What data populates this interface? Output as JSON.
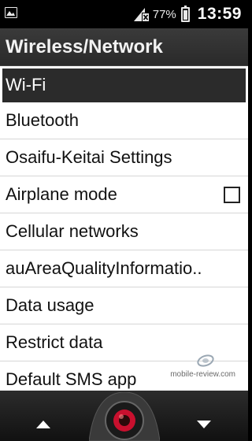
{
  "status_bar": {
    "battery_percent": "77%",
    "battery_level": 0.77,
    "time": "13:59",
    "icons": [
      "gallery-icon",
      "signal-no-sim-icon",
      "battery-icon"
    ]
  },
  "header": {
    "title": "Wireless/Network"
  },
  "settings": {
    "items": [
      {
        "label": "Wi-Fi",
        "selected": true
      },
      {
        "label": "Bluetooth"
      },
      {
        "label": "Osaifu-Keitai Settings"
      },
      {
        "label": "Airplane mode",
        "checked": false
      },
      {
        "label": "Cellular networks"
      },
      {
        "label": "auAreaQualityInformatio.."
      },
      {
        "label": "Data usage"
      },
      {
        "label": "Restrict data"
      },
      {
        "label": "Default SMS app"
      }
    ]
  },
  "watermark": {
    "text": "mobile-review.com"
  },
  "bottom_bar": {
    "icons": [
      "up-arrow-icon",
      "center-select-icon",
      "down-arrow-icon"
    ]
  }
}
